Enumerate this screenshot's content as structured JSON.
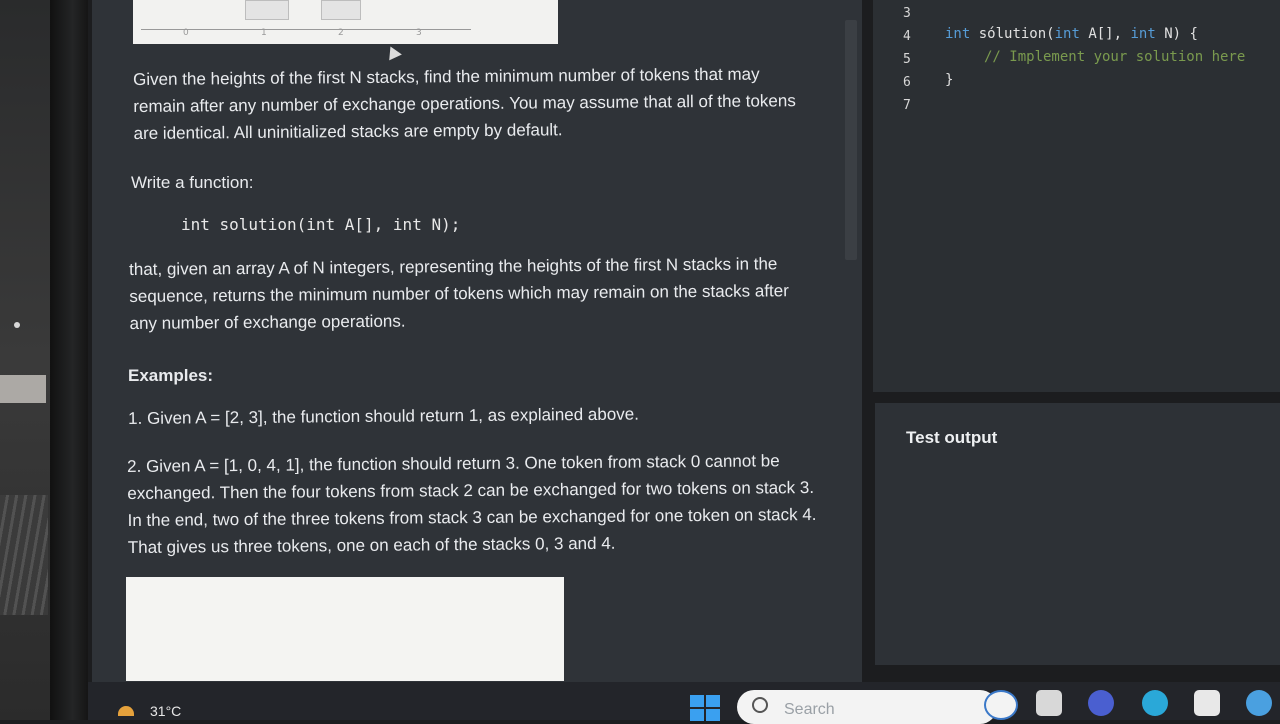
{
  "problem": {
    "intro": "Given the heights of the first N stacks, find the minimum number of tokens that may remain after any number of exchange operations. You may assume that all of the tokens are identical. All uninitialized stacks are empty by default.",
    "write_function": "Write a function:",
    "signature": "int solution(int A[], int N);",
    "description": "that, given an array A of N integers, representing the heights of the first N stacks in the sequence, returns the minimum number of tokens which may remain on the stacks after any number of exchange operations.",
    "examples_heading": "Examples:",
    "example1": "1. Given A = [2, 3], the function should return 1, as explained above.",
    "example2": "2. Given A = [1, 0, 4, 1], the function should return 3. One token from stack 0 cannot be exchanged. Then the four tokens from stack 2 can be exchanged for two tokens on stack 3. In the end, two of the three tokens from stack 3 can be exchanged for one token on stack 4. That gives us three tokens, one on each of the stacks 0, 3 and 4.",
    "figure_ticks": [
      "0",
      "1",
      "2",
      "3"
    ]
  },
  "editor": {
    "line_numbers": [
      "3",
      "4",
      "5",
      "6",
      "7"
    ],
    "line4_kw1": "int",
    "line4_name": " sólution(",
    "line4_kw2": "int",
    "line4_mid": " A[], ",
    "line4_kw3": "int",
    "line4_end": " N) {",
    "line5_comment": "// Implement your solution here",
    "line6_brace": "}"
  },
  "test_output": {
    "title": "Test output"
  },
  "taskbar": {
    "temperature": "31°C",
    "search_placeholder": "Search"
  }
}
